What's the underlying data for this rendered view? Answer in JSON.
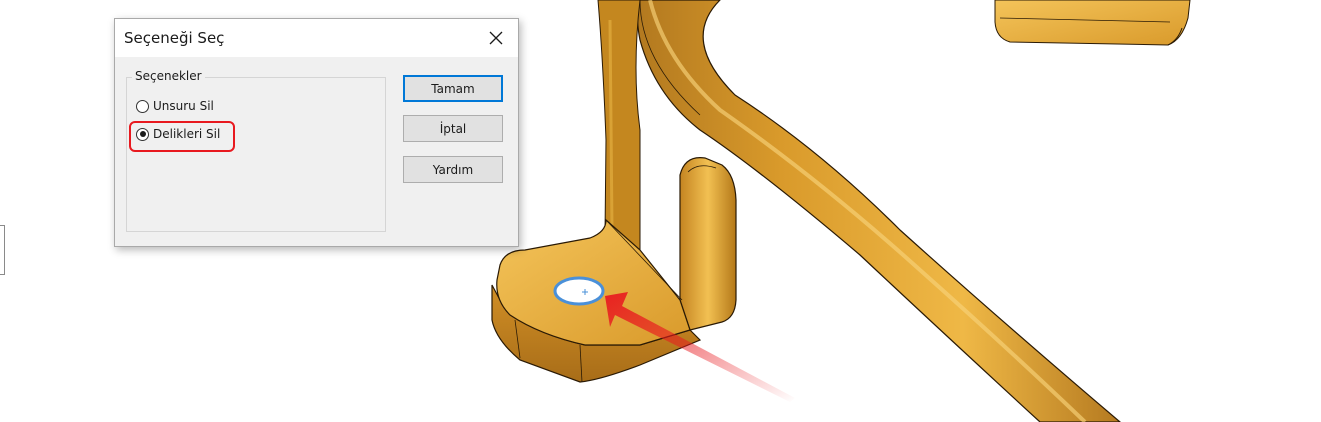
{
  "dialog": {
    "title": "Seçeneği Seç",
    "group_label": "Seçenekler",
    "options": [
      {
        "label": "Unsuru Sil",
        "checked": false
      },
      {
        "label": "Delikleri Sil",
        "checked": true
      }
    ],
    "buttons": {
      "ok": "Tamam",
      "cancel": "İptal",
      "help": "Yardım"
    }
  },
  "icons": {
    "close": "close-icon",
    "annotation_arrow": "arrow-icon",
    "hole_origin": "crosshair-icon"
  },
  "colors": {
    "part_gold": "#d99a2b",
    "part_highlight": "#f6c960",
    "part_shadow": "#8a5a12",
    "annotation_red": "#e8191f",
    "hole_selection": "#4a90d9",
    "default_button_border": "#0078d7"
  }
}
